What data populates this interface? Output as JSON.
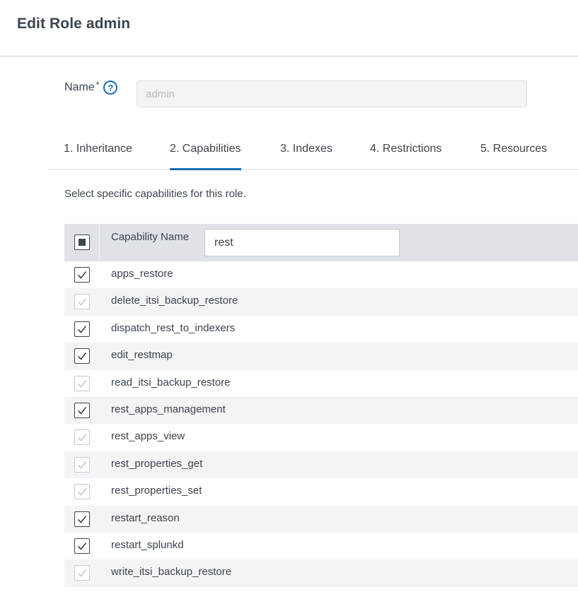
{
  "header": {
    "title": "Edit Role admin"
  },
  "name_field": {
    "label": "Name",
    "required_mark": "*",
    "help_glyph": "?",
    "value": "admin"
  },
  "tabs": [
    {
      "label": "1. Inheritance",
      "active": false
    },
    {
      "label": "2. Capabilities",
      "active": true
    },
    {
      "label": "3. Indexes",
      "active": false
    },
    {
      "label": "4. Restrictions",
      "active": false
    },
    {
      "label": "5. Resources",
      "active": false
    }
  ],
  "description": "Select specific capabilities for this role.",
  "table": {
    "header_label": "Capability Name",
    "filter_value": "rest",
    "select_all_state": "partial",
    "rows": [
      {
        "name": "apps_restore",
        "checked": true,
        "disabled": false
      },
      {
        "name": "delete_itsi_backup_restore",
        "checked": true,
        "disabled": true
      },
      {
        "name": "dispatch_rest_to_indexers",
        "checked": true,
        "disabled": false
      },
      {
        "name": "edit_restmap",
        "checked": true,
        "disabled": false
      },
      {
        "name": "read_itsi_backup_restore",
        "checked": true,
        "disabled": true
      },
      {
        "name": "rest_apps_management",
        "checked": true,
        "disabled": false
      },
      {
        "name": "rest_apps_view",
        "checked": true,
        "disabled": true
      },
      {
        "name": "rest_properties_get",
        "checked": true,
        "disabled": true
      },
      {
        "name": "rest_properties_set",
        "checked": true,
        "disabled": true
      },
      {
        "name": "restart_reason",
        "checked": true,
        "disabled": false
      },
      {
        "name": "restart_splunkd",
        "checked": true,
        "disabled": false
      },
      {
        "name": "write_itsi_backup_restore",
        "checked": true,
        "disabled": true
      }
    ]
  },
  "colors": {
    "accent": "#1a6fb0",
    "text": "#3c444d",
    "header_bg": "#dfe3e8",
    "stripe": "#f2f4f5"
  }
}
